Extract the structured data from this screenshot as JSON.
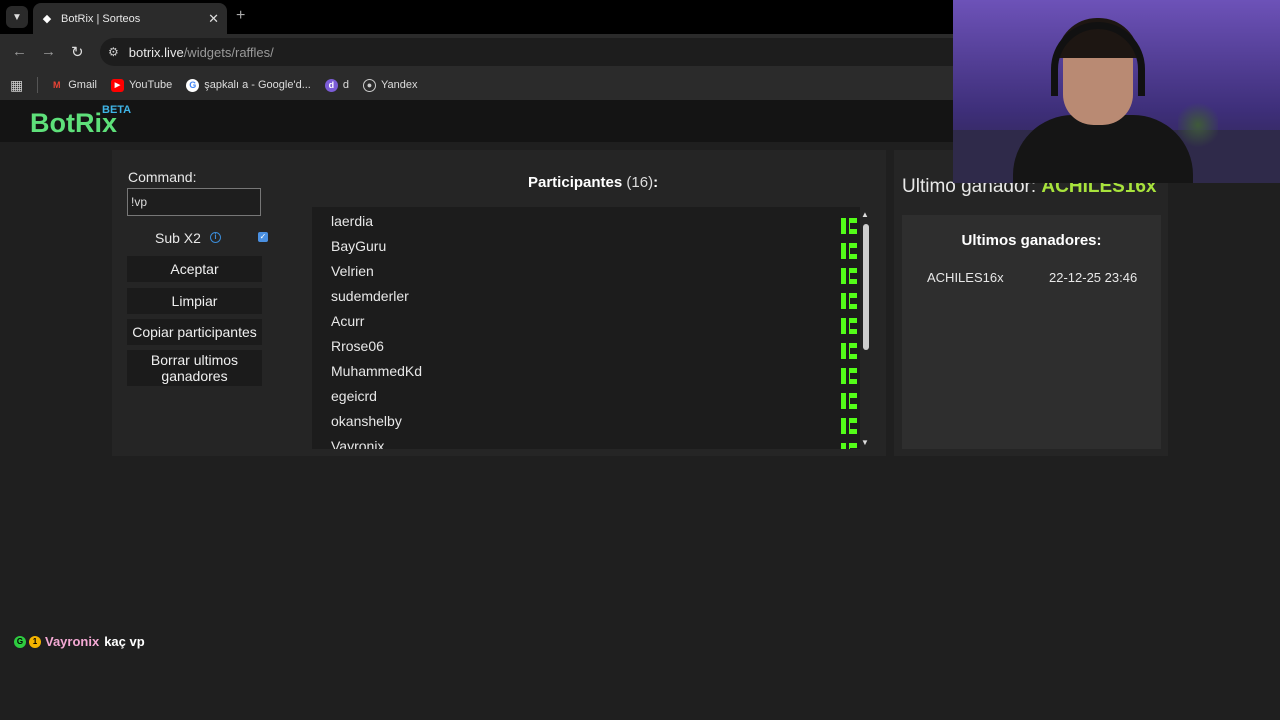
{
  "browser": {
    "tab_title": "BotRix | Sorteos",
    "url_host": "botrix.live",
    "url_path": "/widgets/raffles/",
    "bookmarks": [
      {
        "label": "Gmail",
        "icon": "gmail-icon",
        "color": "#ea4335"
      },
      {
        "label": "YouTube",
        "icon": "youtube-icon",
        "color": "#ff0000"
      },
      {
        "label": "şapkalı a - Google'd...",
        "icon": "google-icon",
        "color": "#ffffff"
      },
      {
        "label": "d",
        "icon": "bookmark-d-icon",
        "color": "#7b5cd6"
      },
      {
        "label": "Yandex",
        "icon": "globe-icon",
        "color": "#cccccc"
      }
    ]
  },
  "app": {
    "logo": "BotRix",
    "beta": "BETA",
    "logo_color": "#5ee07a"
  },
  "controls": {
    "command_label": "Command:",
    "command_value": "!vp",
    "sub_label": "Sub X2",
    "sub_checked": true,
    "accept_label": "Aceptar",
    "clear_label": "Limpiar",
    "copy_label": "Copiar participantes",
    "delete_label_line1": "Borrar ultimos",
    "delete_label_line2": "ganadores"
  },
  "participants": {
    "title": "Participantes",
    "count": "(16)",
    "colon": ":",
    "items": [
      "laerdia",
      "BayGuru",
      "Velrien",
      "sudemderler",
      "Acurr",
      "Rrose06",
      "MuhammedKd",
      "egeicrd",
      "okanshelby",
      "Vayronix"
    ],
    "platform_icon": "kick-icon",
    "platform_color": "#53fc18"
  },
  "winner": {
    "label": "Ultimo ganador:",
    "name": "ACHILES16x",
    "name_color": "#a8e33c"
  },
  "last_winners": {
    "title": "Ultimos ganadores:",
    "rows": [
      {
        "name": "ACHILES16x",
        "date": "22-12-25 23:46"
      }
    ]
  },
  "chat": {
    "badge1": "G",
    "badge2": "1",
    "user": "Vayronix",
    "message": "kaç vp"
  }
}
